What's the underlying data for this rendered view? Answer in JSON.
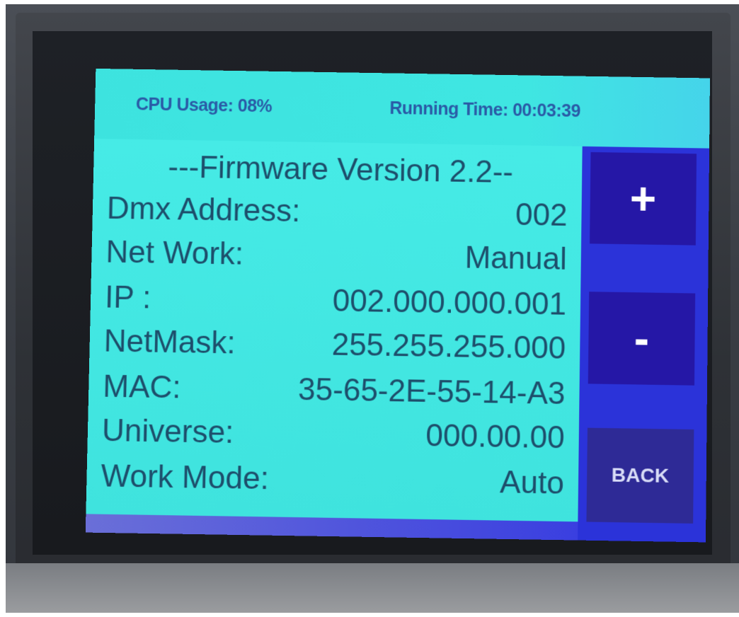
{
  "status_bar": {
    "cpu_usage": "CPU Usage: 08%",
    "running_time": "Running Time: 00:03:39"
  },
  "info": {
    "title": "---Firmware Version 2.2--",
    "rows": [
      {
        "label": "Dmx Address:",
        "value": "002"
      },
      {
        "label": "Net Work:",
        "value": "Manual"
      },
      {
        "label": "IP :",
        "value": "002.000.000.001"
      },
      {
        "label": "NetMask:",
        "value": "255.255.255.000"
      },
      {
        "label": "MAC:",
        "value": "35-65-2E-55-14-A3"
      },
      {
        "label": "Universe:",
        "value": "000.00.00"
      },
      {
        "label": "Work Mode:",
        "value": "Auto"
      }
    ]
  },
  "buttons": {
    "plus": "+",
    "minus": "-",
    "back": "BACK"
  },
  "colors": {
    "screen_background": "#3fe3de",
    "side_panel": "#2b33d9",
    "button": "#2517a6",
    "text": "#1d4e6b",
    "status_text": "#2a5aa6"
  }
}
